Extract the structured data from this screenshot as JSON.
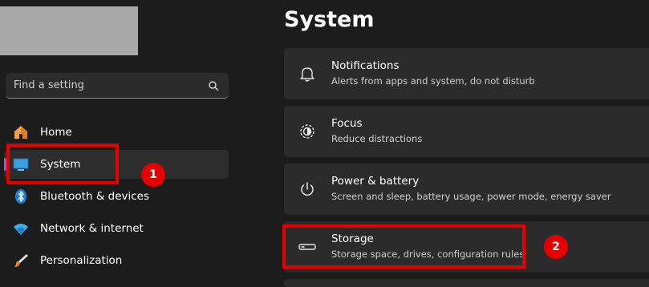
{
  "search": {
    "placeholder": "Find a setting"
  },
  "sidebar": {
    "items": [
      {
        "label": "Home",
        "icon": "home-icon"
      },
      {
        "label": "System",
        "icon": "monitor-icon",
        "selected": true
      },
      {
        "label": "Bluetooth & devices",
        "icon": "bluetooth-icon"
      },
      {
        "label": "Network & internet",
        "icon": "wifi-icon"
      },
      {
        "label": "Personalization",
        "icon": "brush-icon"
      }
    ]
  },
  "main": {
    "title": "System",
    "cards": [
      {
        "title": "Notifications",
        "subtitle": "Alerts from apps and system, do not disturb",
        "icon": "bell-icon"
      },
      {
        "title": "Focus",
        "subtitle": "Reduce distractions",
        "icon": "focus-icon"
      },
      {
        "title": "Power & battery",
        "subtitle": "Screen and sleep, battery usage, power mode, energy saver",
        "icon": "power-icon"
      },
      {
        "title": "Storage",
        "subtitle": "Storage space, drives, configuration rules",
        "icon": "drive-icon"
      }
    ]
  },
  "annotations": {
    "badge_1": "1",
    "badge_2": "2",
    "color": "#e50000"
  },
  "colors": {
    "background": "#1c1c1c",
    "card": "#2b2b2b",
    "accent": "#9b59d6"
  }
}
